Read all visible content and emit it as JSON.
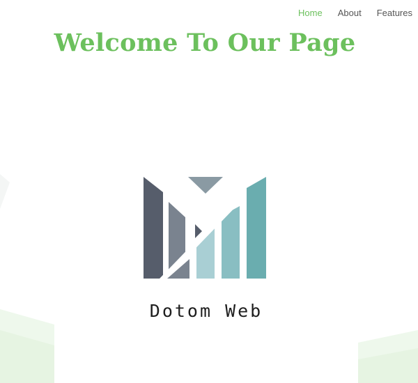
{
  "nav": {
    "items": [
      {
        "label": "Home",
        "active": true
      },
      {
        "label": "About",
        "active": false
      },
      {
        "label": "Features",
        "active": false
      }
    ]
  },
  "hero": {
    "title": "Welcome To Our Page"
  },
  "logo": {
    "text": "Dotom Web",
    "icon": "dotom-m-bars-logo"
  },
  "colors": {
    "accent": "#6cc05d",
    "nav_text": "#555555",
    "logo_text": "#1e1e1e",
    "logo_bar_dark": "#565d6b",
    "logo_bar_mid": "#7a838f",
    "logo_bar_light": "#a9cfd4",
    "logo_bar_teal": "#6aadaf",
    "background_wave": "#eaf6e7"
  }
}
